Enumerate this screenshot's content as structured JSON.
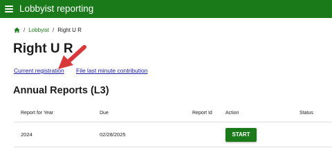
{
  "header": {
    "menu_icon": "hamburger-menu-icon",
    "title": "Lobbyist reporting"
  },
  "breadcrumb": {
    "home_icon": "home-icon",
    "separator": "/",
    "parent": "Lobbyist",
    "current": "Right U R"
  },
  "page": {
    "title": "Right U R"
  },
  "links": {
    "current_registration": "Current registration",
    "file_last_minute": "File last minute contribution"
  },
  "annotation": {
    "arrow_color": "#d9383a"
  },
  "annual_reports": {
    "title": "Annual Reports (L3)",
    "columns": [
      "Report for Year",
      "Due",
      "Report Id",
      "Action",
      "Status"
    ],
    "rows": [
      {
        "year": "2024",
        "due": "02/28/2025",
        "report_id": "",
        "action_label": "START",
        "status": ""
      }
    ]
  },
  "colors": {
    "brand_green": "#1a7a1a",
    "link_blue": "#1a1aa8"
  }
}
